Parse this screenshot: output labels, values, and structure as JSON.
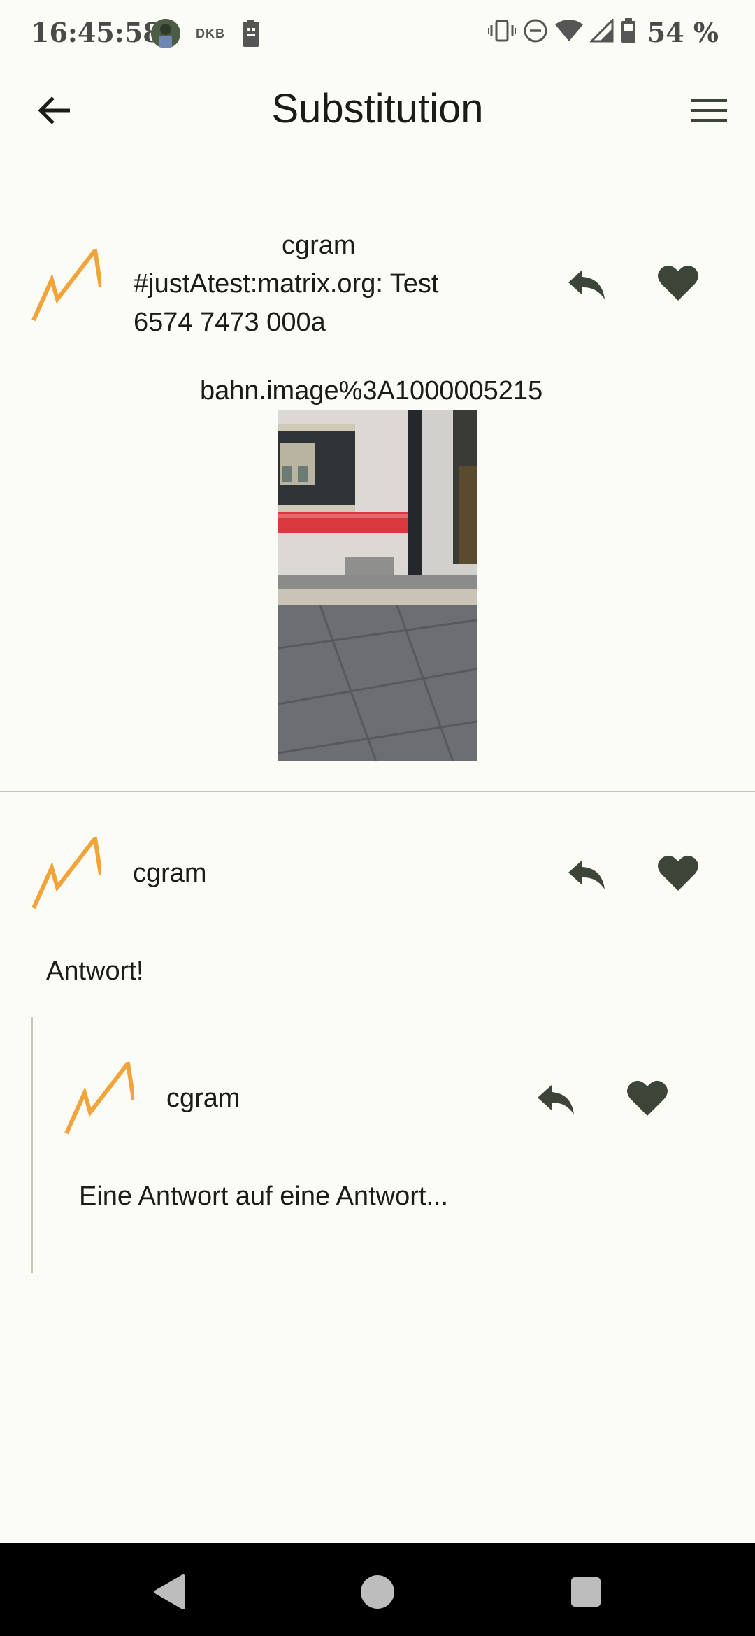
{
  "status_bar": {
    "time": "16:45:58",
    "notification_label": "DKB",
    "battery": "54 %"
  },
  "app_bar": {
    "title": "Substitution"
  },
  "colors": {
    "background": "#fcfcf7",
    "icon": "#3d4539",
    "logo_orange": "#f2a33a",
    "divider": "#c6c7bf",
    "nav_bar": "#000000"
  },
  "posts": [
    {
      "author": "cgram",
      "text_line1": "#justAtest:matrix.org: Test",
      "text_line2": "6574 7473 000a",
      "attachment_name": "bahn.image%3A1000005215"
    },
    {
      "author": "cgram",
      "body": "Antwort!"
    },
    {
      "author": "cgram",
      "body": "Eine Antwort auf eine Antwort..."
    }
  ],
  "icons": {
    "back": "arrow-back-icon",
    "menu": "hamburger-menu-icon",
    "reply": "reply-icon",
    "like": "heart-icon",
    "logo": "matrix-m-logo-icon"
  }
}
